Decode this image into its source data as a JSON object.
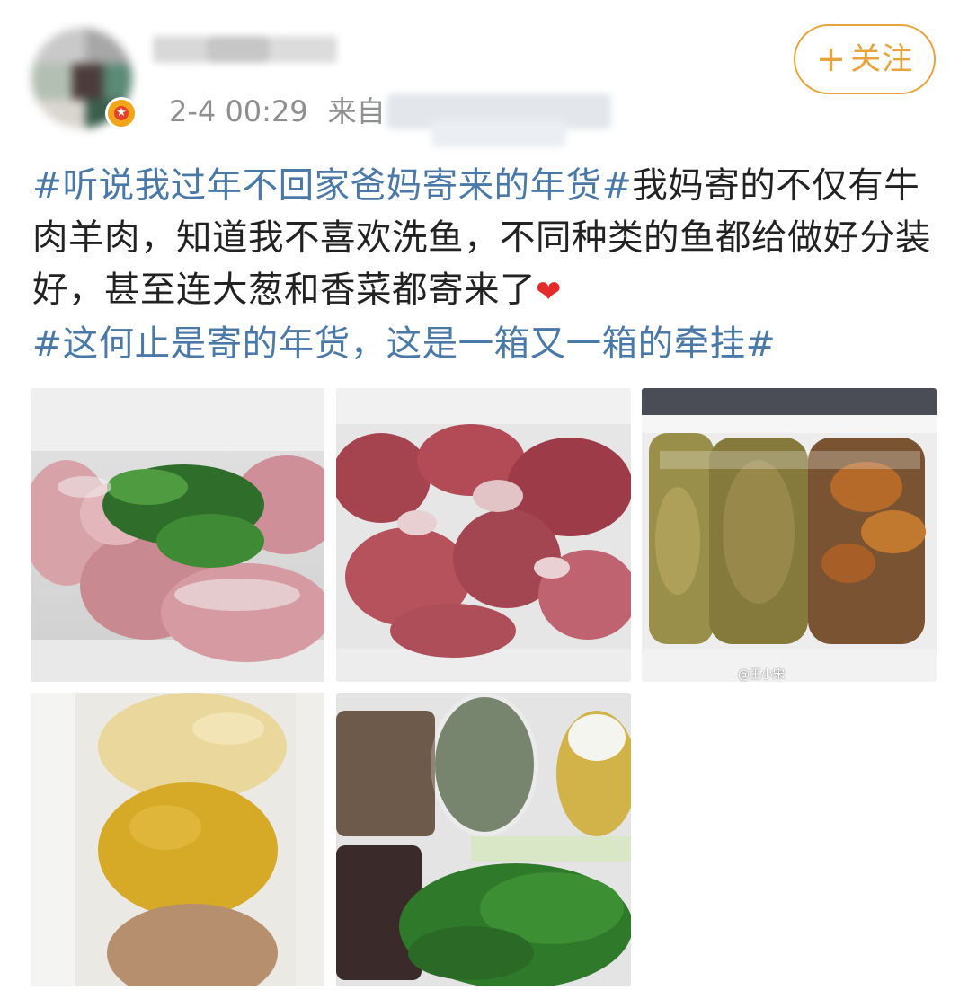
{
  "header": {
    "timestamp": "2-4 00:29",
    "source_prefix": "来自",
    "follow_plus": "+",
    "follow_label": "关注"
  },
  "post": {
    "hashtag_1": "#听说我过年不回家爸妈寄来的年货#",
    "body_text": "我妈寄的不仅有牛肉羊肉，知道我不喜欢洗鱼，不同种类的鱼都给做好分装好，甚至连大葱和香菜都寄来了",
    "heart_emoji": "❤",
    "hashtag_2": "#这何止是寄的年货，这是一箱又一箱的牵挂#"
  },
  "photos": [
    {
      "id": 1,
      "subject": "frozen lamb meat with cilantro in foam box"
    },
    {
      "id": 2,
      "subject": "chunks of beef and lamb in foam box"
    },
    {
      "id": 3,
      "subject": "bagged fried fish in foam box",
      "watermark": "@王小宋"
    },
    {
      "id": 4,
      "subject": "bagged dough balls"
    },
    {
      "id": 5,
      "subject": "bags of dried vegetables, cilantro and scallions"
    }
  ],
  "colors": {
    "hashtag": "#4a79a8",
    "follow_accent": "#e8a33c",
    "meta_gray": "#8f8f8f",
    "heart": "#e42a2a"
  }
}
